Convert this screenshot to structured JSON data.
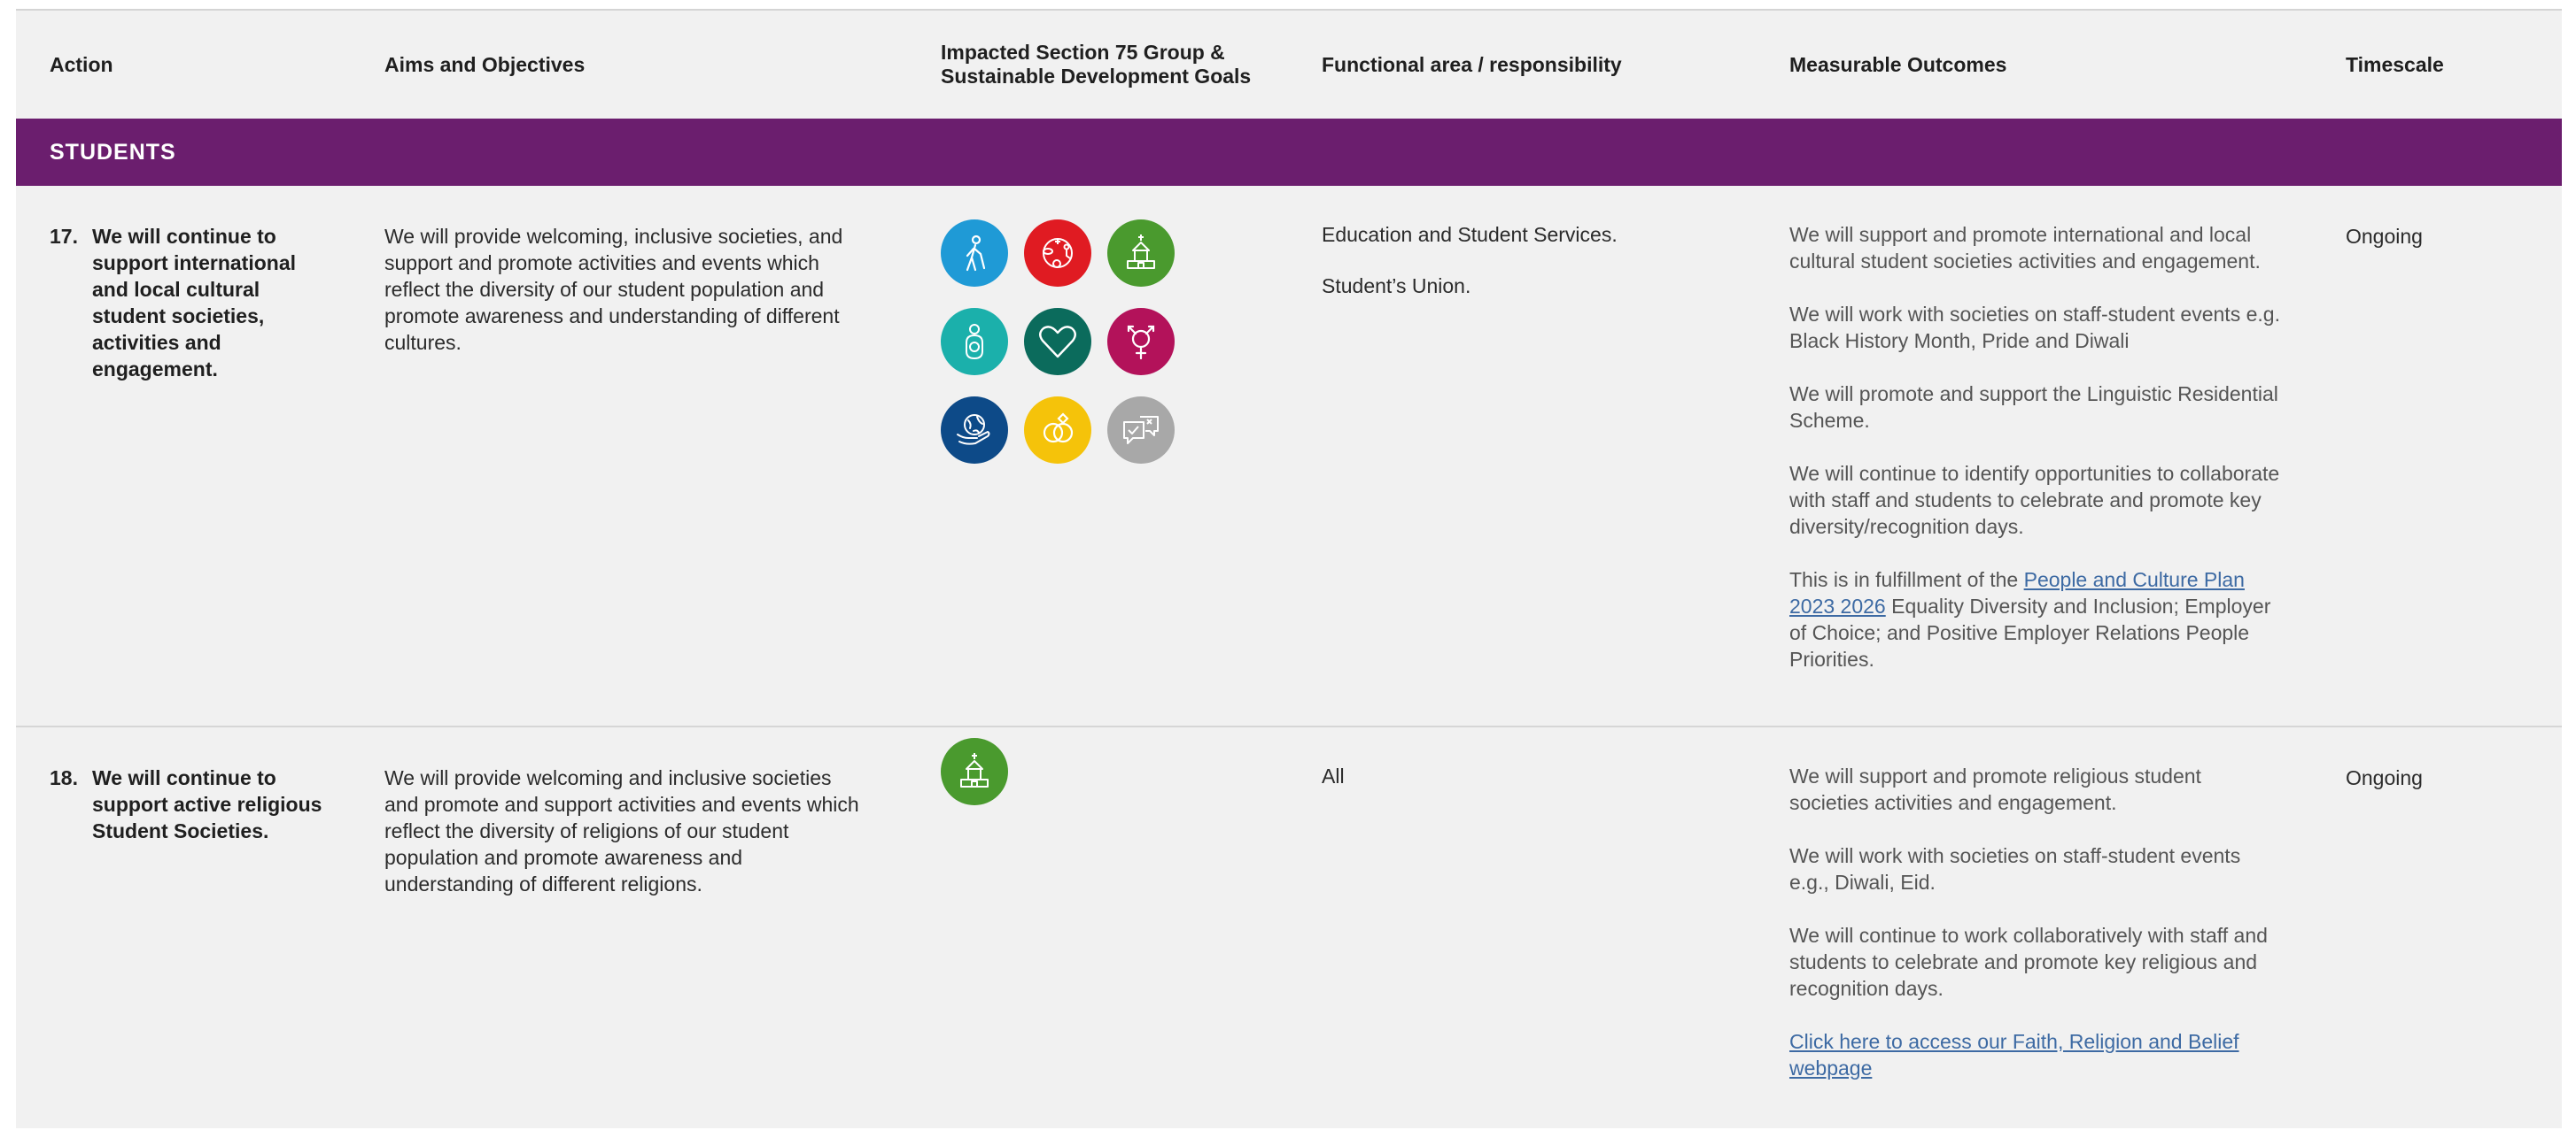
{
  "header": {
    "action": "Action",
    "aims": "Aims and Objectives",
    "impacted_line1": "Impacted Section 75 Group &",
    "impacted_line2": "Sustainable Development Goals",
    "functional": "Functional area / responsibility",
    "outcomes": "Measurable Outcomes",
    "timescale": "Timescale"
  },
  "band": {
    "label": "STUDENTS",
    "color": "#6b1e6e"
  },
  "rows": [
    {
      "number": "17.",
      "action": "We will continue to support international and local cultural student societies, activities and engagement.",
      "aims": "We will provide welcoming, inclusive societies, and support and promote activities and events which reflect the diversity of our student population and promote awareness and understanding of different cultures.",
      "icons": [
        {
          "name": "age-icon",
          "color": "#1f9ad6"
        },
        {
          "name": "disability-icon",
          "color": "#e01b22"
        },
        {
          "name": "religion-icon",
          "color": "#4a9a2e"
        },
        {
          "name": "dependants-icon",
          "color": "#1bb0ab"
        },
        {
          "name": "heart-icon",
          "color": "#0b6b5c"
        },
        {
          "name": "gender-icon",
          "color": "#b3125a"
        },
        {
          "name": "race-icon",
          "color": "#0d4a88"
        },
        {
          "name": "marital-status-icon",
          "color": "#f5c30a"
        },
        {
          "name": "political-opinion-icon",
          "color": "#a8a8a8"
        }
      ],
      "functional": [
        "Education and Student Services.",
        "Student’s Union."
      ],
      "outcomes": {
        "p1": "We will support and promote international and local cultural student societies activities and engagement.",
        "p2": "We will work with societies on staff-student events e.g. Black History Month, Pride and Diwali",
        "p3": "We will promote and support the Linguistic Residential Scheme.",
        "p4": "We will continue to identify opportunities to collaborate with staff and students to celebrate and promote key diversity/recognition days.",
        "p5_before": "This is in fulfillment of the ",
        "p5_link": "People and Culture Plan 2023 2026",
        "p5_after": " Equality Diversity and Inclusion; Employer of Choice; and Positive Employer Relations People Priorities."
      },
      "timescale": "Ongoing"
    },
    {
      "number": "18.",
      "action": "We will continue to support active religious Student Societies.",
      "aims": "We will provide welcoming and inclusive societies and promote and support activities and events which reflect the diversity of religions of our student population and promote awareness and understanding of different religions.",
      "icons": [
        {
          "name": "religion-icon",
          "color": "#4a9a2e"
        }
      ],
      "functional": [
        "All"
      ],
      "outcomes": {
        "p1": "We will support and promote religious student societies activities and engagement.",
        "p2": "We will work with societies on staff-student events e.g., Diwali, Eid.",
        "p3": "We will continue to work collaboratively with staff and students to celebrate and promote key religious and recognition days.",
        "p4_link": "Click here to access our Faith, Religion and Belief webpage"
      },
      "timescale": "Ongoing"
    }
  ]
}
